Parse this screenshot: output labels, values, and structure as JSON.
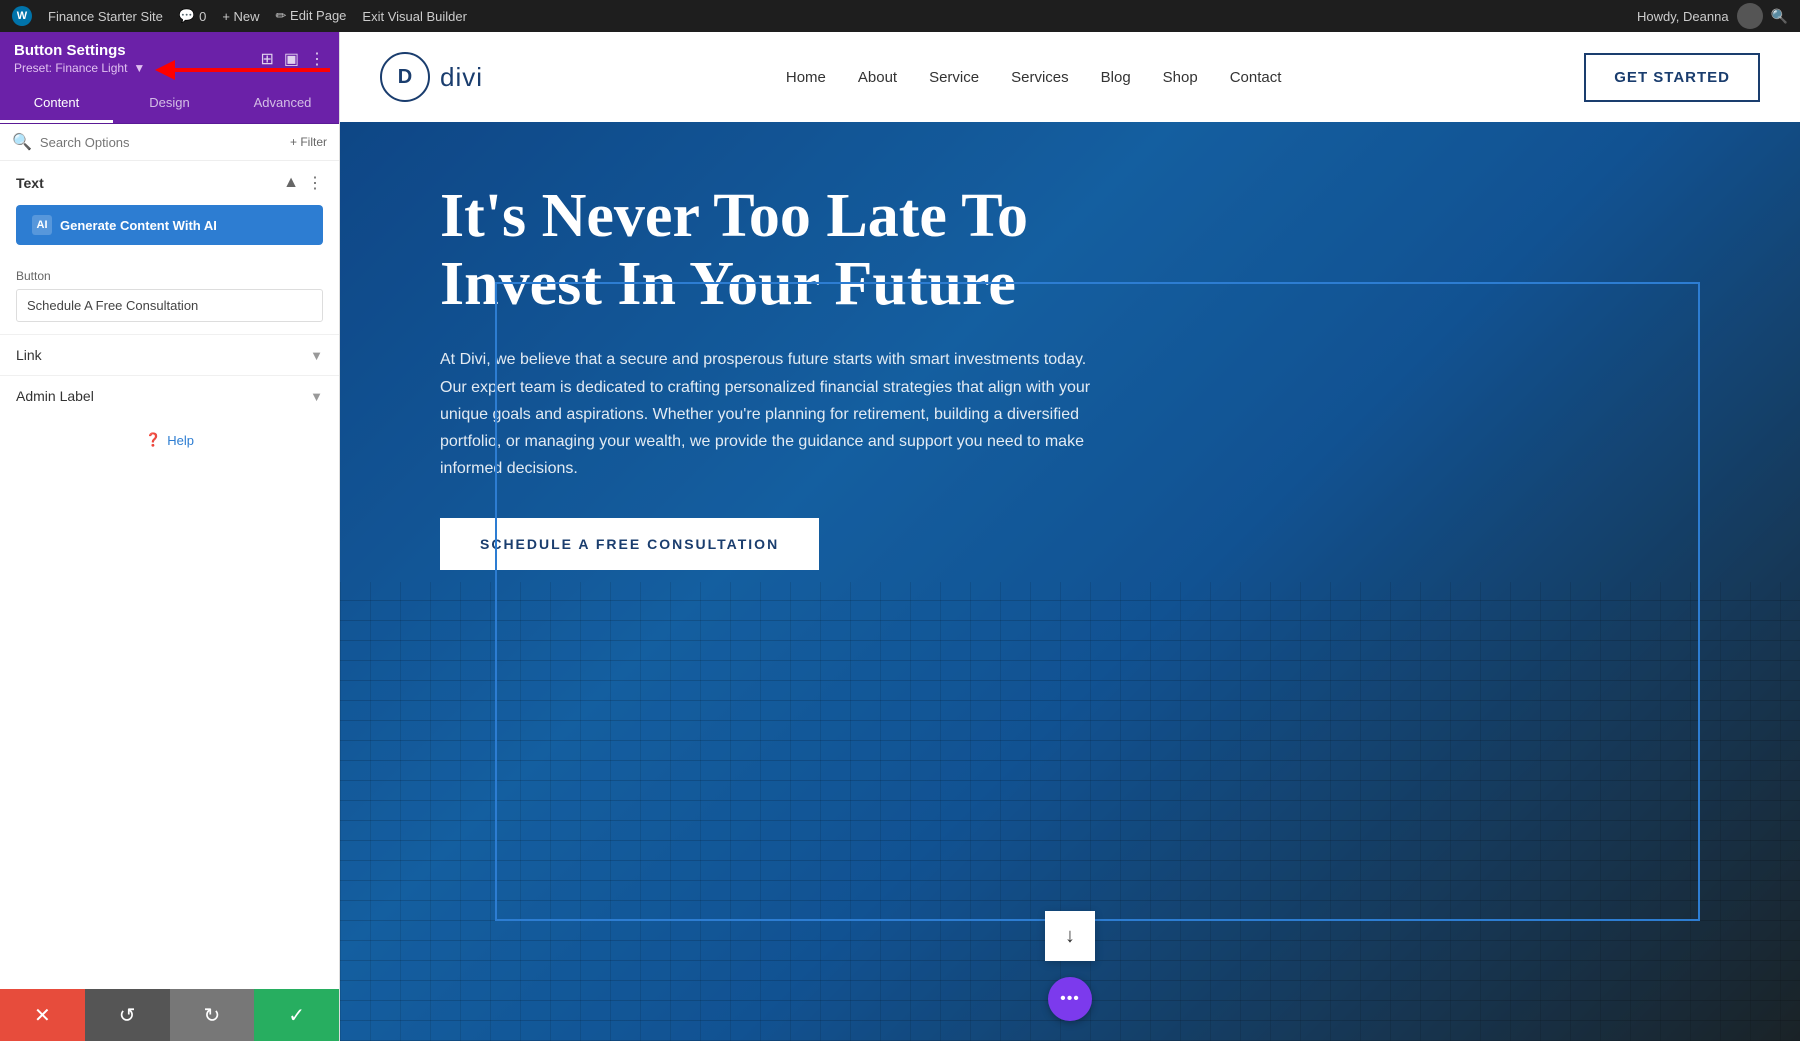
{
  "admin_bar": {
    "wp_logo": "W",
    "site_name": "Finance Starter Site",
    "comment_icon": "💬",
    "comment_count": "0",
    "new_label": "+ New",
    "edit_page": "✏ Edit Page",
    "exit_builder": "Exit Visual Builder",
    "howdy": "Howdy, Deanna",
    "search_icon": "🔍"
  },
  "sidebar": {
    "title": "Button Settings",
    "preset": "Preset: Finance Light",
    "tabs": [
      "Content",
      "Design",
      "Advanced"
    ],
    "active_tab": "Content",
    "search_placeholder": "Search Options",
    "filter_label": "+ Filter",
    "text_section_title": "Text",
    "ai_button_label": "Generate Content With AI",
    "ai_icon_label": "AI",
    "button_section_title": "Button",
    "button_input_value": "Schedule A Free Consultation",
    "link_section_title": "Link",
    "admin_label_section_title": "Admin Label",
    "help_label": "Help",
    "action_cancel": "✕",
    "action_undo": "↺",
    "action_redo": "↻",
    "action_save": "✓"
  },
  "site_nav": {
    "logo_letter": "D",
    "logo_name": "divi",
    "links": [
      "Home",
      "About",
      "Service",
      "Services",
      "Blog",
      "Shop",
      "Contact"
    ],
    "cta_button": "GET STARTED"
  },
  "hero": {
    "title_line1": "It's Never Too Late To",
    "title_line2": "Invest In Your Future",
    "description": "At Divi, we believe that a secure and prosperous future starts with smart investments today. Our expert team is dedicated to crafting personalized financial strategies that align with your unique goals and aspirations. Whether you're planning for retirement, building a diversified portfolio, or managing your wealth, we provide the guidance and support you need to make informed decisions.",
    "cta_button": "SCHEDULE A FREE CONSULTATION",
    "scroll_down_icon": "↓",
    "dots_icon": "•••"
  },
  "colors": {
    "sidebar_header_bg": "#6b21a8",
    "active_tab_border": "#ffffff",
    "ai_button_bg": "#2d7dd2",
    "save_button_bg": "#27ae60",
    "cancel_button_bg": "#e74c3c",
    "hero_bg_start": "#1565c0",
    "hero_bg_end": "#263238",
    "nav_text": "#1a3d6e",
    "dots_btn_bg": "#7c3aed"
  }
}
